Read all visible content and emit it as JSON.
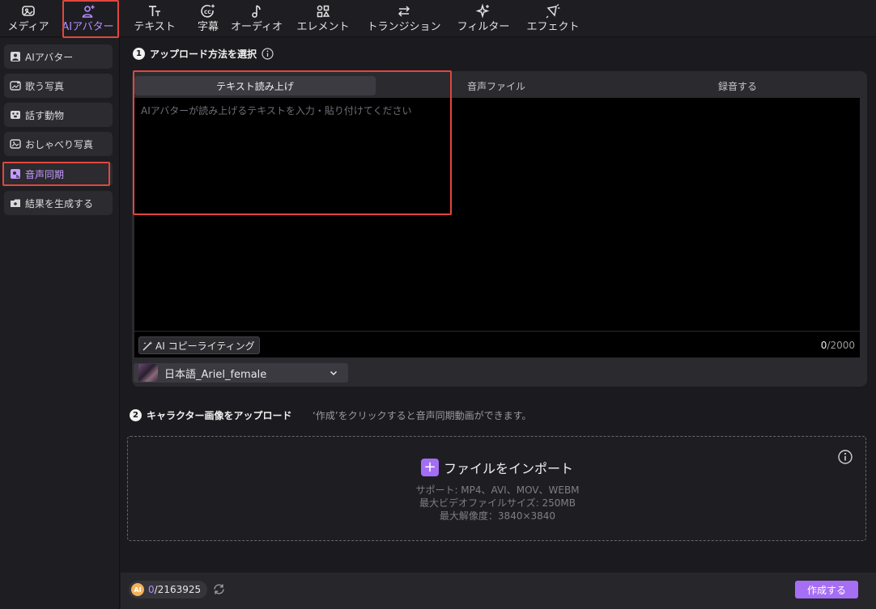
{
  "toolbar": {
    "items": [
      {
        "label": "メディア",
        "icon": "media-icon"
      },
      {
        "label": "AIアバター",
        "icon": "ai-avatar-icon"
      },
      {
        "label": "テキスト",
        "icon": "text-icon"
      },
      {
        "label": "字幕",
        "icon": "caption-icon"
      },
      {
        "label": "オーディオ",
        "icon": "audio-icon"
      },
      {
        "label": "エレメント",
        "icon": "element-icon"
      },
      {
        "label": "トランジション",
        "icon": "transition-icon"
      },
      {
        "label": "フィルター",
        "icon": "filter-icon"
      },
      {
        "label": "エフェクト",
        "icon": "effect-icon"
      }
    ],
    "active_index": 1
  },
  "sidebar": {
    "items": [
      {
        "label": "AIアバター",
        "icon": "avatar-icon"
      },
      {
        "label": "歌う写真",
        "icon": "singing-photo-icon"
      },
      {
        "label": "話す動物",
        "icon": "talking-animal-icon"
      },
      {
        "label": "おしゃべり写真",
        "icon": "talking-photo-icon"
      },
      {
        "label": "音声同期",
        "icon": "voice-sync-icon"
      },
      {
        "label": "結果を生成する",
        "icon": "generate-result-icon"
      }
    ],
    "active_index": 4
  },
  "step1": {
    "number": "1",
    "title": "アップロード方法を選択"
  },
  "upload_tabs": [
    "テキスト読み上げ",
    "音声ファイル",
    "録音する"
  ],
  "text_input": {
    "placeholder": "AIアバターが読み上げるテキストを入力・貼り付けてください",
    "value": "",
    "copywriting_label": "AI コピーライティング",
    "count_current": "0",
    "count_max": "/2000"
  },
  "voice": {
    "selected": "日本語_Ariel_female"
  },
  "step2": {
    "number": "2",
    "title": "キャラクター画像をアップロード",
    "hint": "‘作成’をクリックすると音声同期動画ができます。"
  },
  "upload": {
    "import_label": "ファイルをインポート",
    "support_lines": [
      "サポート: MP4、AVI、MOV、WEBM",
      "最大ビデオファイルサイズ: 250MB",
      "最大解像度：3840×3840"
    ]
  },
  "footer": {
    "coin_label": "AI",
    "credits_used": "0",
    "credits_total": "/2163925",
    "create_label": "作成する"
  },
  "colors": {
    "accent": "#a56ef4",
    "highlight": "#e0473f",
    "background": "#1b1b1f"
  }
}
